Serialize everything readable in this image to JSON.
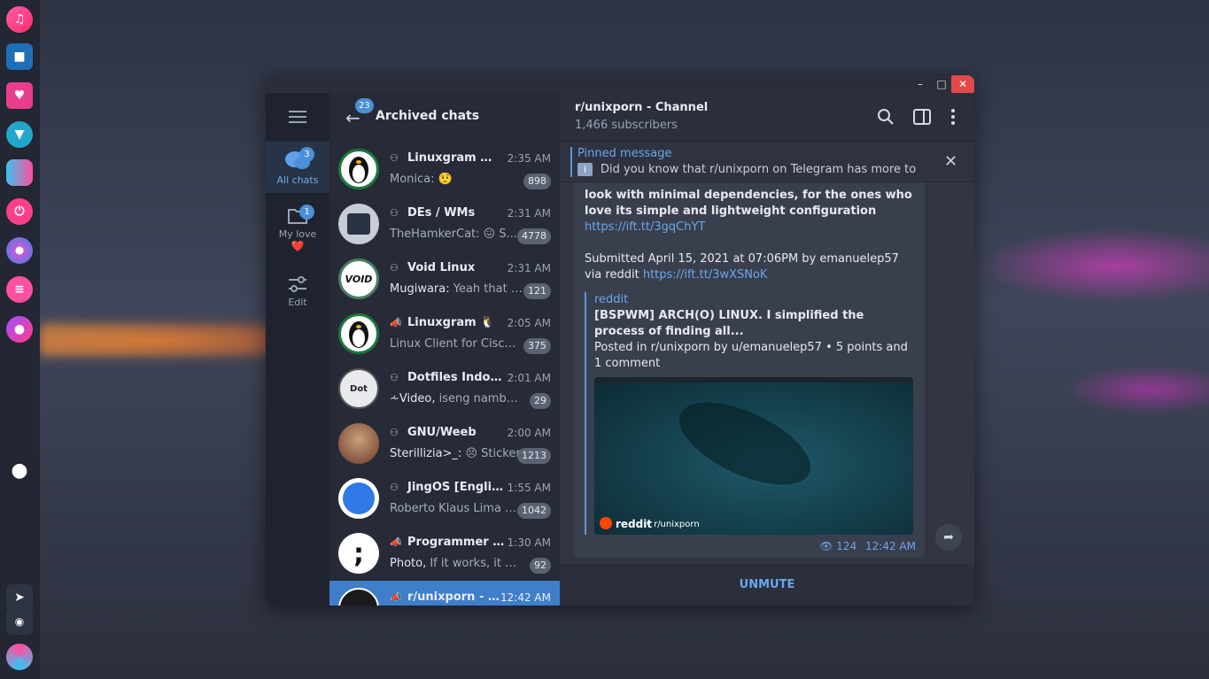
{
  "dock": {
    "bottom_dot": "●"
  },
  "window": {
    "minimize": "–",
    "maximize": "□",
    "close": "✕"
  },
  "folders": [
    {
      "label": "All chats",
      "badge": "3",
      "icon": "chat-bubbles-icon"
    },
    {
      "label": "My love",
      "emoji": "❤️",
      "badge": "1",
      "icon": "folder-icon"
    },
    {
      "label": "Edit",
      "icon": "sliders-icon"
    }
  ],
  "chatlist": {
    "back_badge": "23",
    "title": "Archived chats",
    "chats": [
      {
        "title": "Linuxgram 🐧 ...",
        "time": "2:35 AM",
        "preview": "Monica: 🤨",
        "count": "898",
        "type": "group"
      },
      {
        "title": "DEs / WMs",
        "time": "2:31 AM",
        "preview": "TheHamkerCat: 😖 S...",
        "count": "4778",
        "type": "group"
      },
      {
        "title": "Void Linux",
        "time": "2:31 AM",
        "sender": "Mugiwara:",
        "preview": " Yeah that i...",
        "count": "121",
        "type": "group"
      },
      {
        "title": "Linuxgram 🐧",
        "time": "2:05 AM",
        "preview": "Linux Client for Cisco ...",
        "count": "375",
        "type": "channel"
      },
      {
        "title": "Dotfiles Indon...",
        "time": "2:01 AM",
        "sender": "⩪Video,",
        "preview": " iseng nambahi...",
        "count": "29",
        "type": "group"
      },
      {
        "title": "GNU/Weeb",
        "time": "2:00 AM",
        "sender": "Sterillizia>_:",
        "preview": " 😣 Sticker",
        "count": "1213",
        "type": "group"
      },
      {
        "title": "JingOS [English]",
        "time": "1:55 AM",
        "preview": "Roberto Klaus Lima S...",
        "count": "1042",
        "type": "group"
      },
      {
        "title": "Programmer Jo...",
        "time": "1:30 AM",
        "sender": "Photo,",
        "preview": " If it works, it wor...",
        "count": "92",
        "type": "channel"
      },
      {
        "title": "r/unixporn - C...",
        "time": "12:42 AM",
        "preview": "",
        "count": "",
        "type": "channel"
      }
    ]
  },
  "convo": {
    "title": "r/unixporn - Channel",
    "subtitle": "1,466 subscribers",
    "pinned_label": "Pinned message",
    "pinned_text": "Did you know that r/unixporn on Telegram has more to o...",
    "message": {
      "text1": "look with minimal dependencies, for the ones who love its simple and lightweight configuration",
      "link1": "https://ift.tt/3gqChYT",
      "submitted": "Submitted April 15, 2021 at 07:06PM by emanuelep57",
      "via": "via reddit",
      "link2": "https://ift.tt/3wXSNoK",
      "preview_site": "reddit",
      "preview_title": "[BSPWM] ARCH(O) LINUX. I simplified the process of finding all...",
      "preview_desc": "Posted in r/unixporn by u/emanuelep57 • 5 points and 1 comment",
      "image_brand": "reddit",
      "image_sub": "• r/unixporn",
      "views": "124",
      "time": "12:42 AM"
    },
    "unmute": "UNMUTE"
  }
}
